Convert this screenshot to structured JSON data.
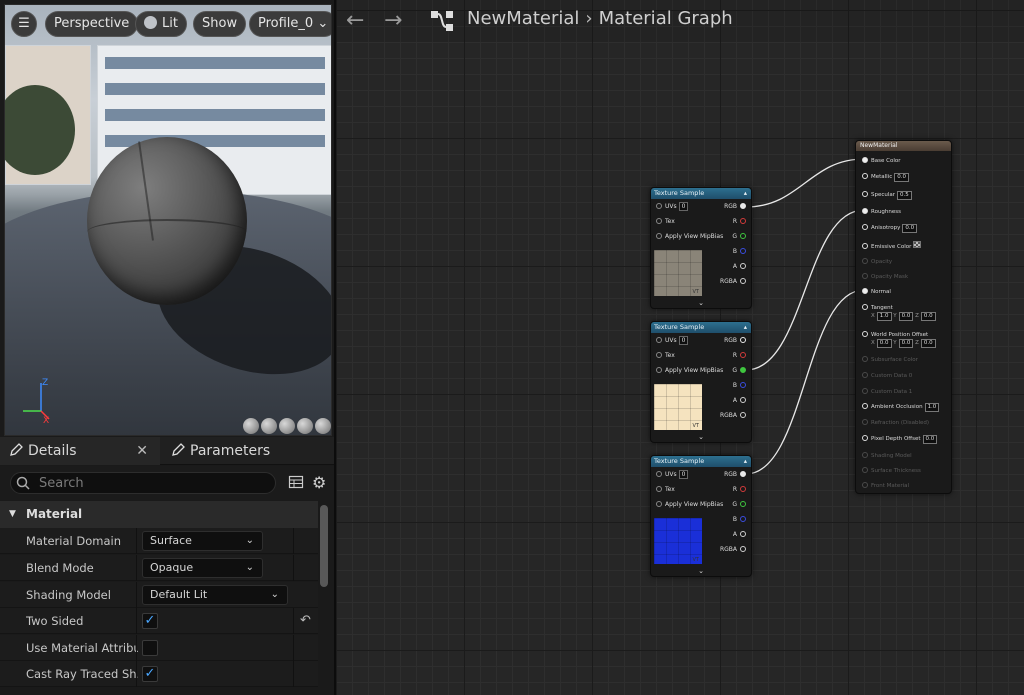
{
  "viewport": {
    "perspective_label": "Perspective",
    "lit_label": "Lit",
    "show_label": "Show",
    "profile_label": "Profile_0"
  },
  "details_panel": {
    "tab_details": "Details",
    "tab_parameters": "Parameters",
    "search_placeholder": "Search",
    "section": "Material",
    "properties": [
      {
        "label": "Material Domain",
        "type": "dropdown",
        "value": "Surface"
      },
      {
        "label": "Blend Mode",
        "type": "dropdown",
        "value": "Opaque"
      },
      {
        "label": "Shading Model",
        "type": "dropdown",
        "value": "Default Lit"
      },
      {
        "label": "Two Sided",
        "type": "checkbox",
        "checked": true
      },
      {
        "label": "Use Material Attribu...",
        "type": "checkbox",
        "checked": false
      },
      {
        "label": "Cast Ray Traced Sh...",
        "type": "checkbox",
        "checked": true
      }
    ]
  },
  "graph": {
    "breadcrumb_asset": "NewMaterial",
    "breadcrumb_graph": "Material Graph",
    "texture_nodes": [
      {
        "title": "Texture Sample",
        "uvs_label": "UVs",
        "uvs_value": "0",
        "tex_label": "Tex",
        "mip_label": "Apply View MipBias",
        "outputs": [
          "RGB",
          "R",
          "G",
          "B",
          "A",
          "RGBA"
        ],
        "thumb_label": "VT",
        "connected_output": "RGB",
        "thumb_color": "#8a8478"
      },
      {
        "title": "Texture Sample",
        "uvs_label": "UVs",
        "uvs_value": "0",
        "tex_label": "Tex",
        "mip_label": "Apply View MipBias",
        "outputs": [
          "RGB",
          "R",
          "G",
          "B",
          "A",
          "RGBA"
        ],
        "thumb_label": "VT",
        "connected_output": "G",
        "thumb_color": "#f5e3bf"
      },
      {
        "title": "Texture Sample",
        "uvs_label": "UVs",
        "uvs_value": "0",
        "tex_label": "Tex",
        "mip_label": "Apply View MipBias",
        "outputs": [
          "RGB",
          "R",
          "G",
          "B",
          "A",
          "RGBA"
        ],
        "thumb_label": "VT",
        "connected_output": "RGB",
        "thumb_color": "#1a2fd8"
      }
    ],
    "output_node": {
      "title": "NewMaterial",
      "inputs": [
        {
          "label": "Base Color",
          "connected": true
        },
        {
          "label": "Metallic",
          "value": "0.0"
        },
        {
          "label": "Specular",
          "value": "0.5"
        },
        {
          "label": "Roughness",
          "connected": true
        },
        {
          "label": "Anisotropy",
          "value": "0.0"
        },
        {
          "label": "Emissive Color",
          "swatch": true
        },
        {
          "label": "Opacity",
          "dim": true
        },
        {
          "label": "Opacity Mask",
          "dim": true
        },
        {
          "label": "Normal",
          "connected": true
        },
        {
          "label": "Tangent",
          "xyz": [
            "1.0",
            "0.0",
            "0.0"
          ]
        },
        {
          "label": "World Position Offset",
          "xyz": [
            "0.0",
            "0.0",
            "0.0"
          ]
        },
        {
          "label": "Subsurface Color",
          "dim": true
        },
        {
          "label": "Custom Data 0",
          "dim": true
        },
        {
          "label": "Custom Data 1",
          "dim": true
        },
        {
          "label": "Ambient Occlusion",
          "value": "1.0"
        },
        {
          "label": "Refraction (Disabled)",
          "dim": true
        },
        {
          "label": "Pixel Depth Offset",
          "value": "0.0"
        },
        {
          "label": "Shading Model",
          "dim": true
        },
        {
          "label": "Surface Thickness",
          "dim": true
        },
        {
          "label": "Front Material",
          "dim": true
        }
      ]
    }
  },
  "colors": {
    "accent_blue": "#4aa7ff",
    "node_header": "#2d6f8f",
    "output_header": "#6a5a4c",
    "pin_red": "#d43b3b",
    "pin_green": "#3fc63f",
    "pin_blue": "#3a4de0"
  }
}
